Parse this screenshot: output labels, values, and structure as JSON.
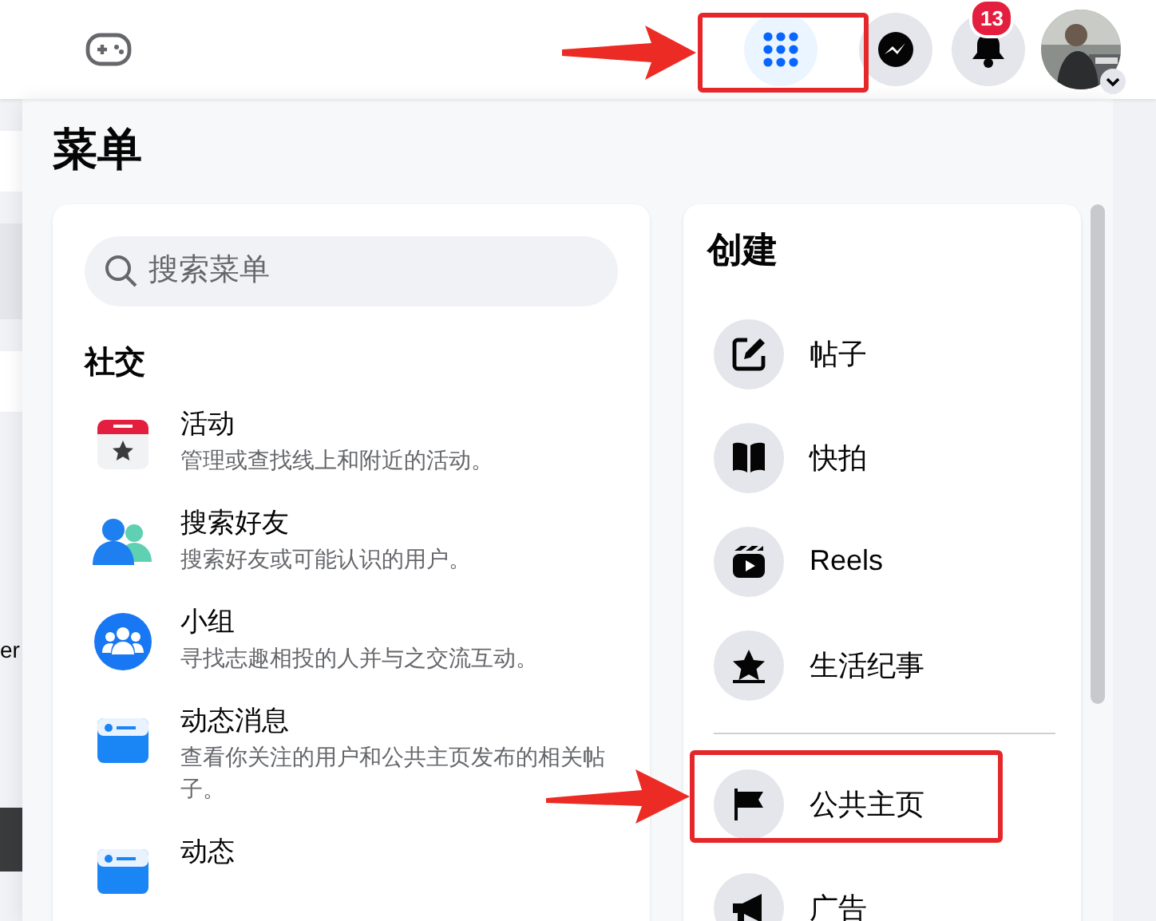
{
  "side_fragment": "er",
  "nav_buttons": [
    {
      "kind": "menu",
      "selected": true
    },
    {
      "kind": "messenger",
      "selected": false
    },
    {
      "kind": "notifications",
      "selected": false,
      "badge": "13"
    }
  ],
  "menu": {
    "title": "菜单",
    "search": {
      "placeholder": "搜索菜单"
    },
    "social": {
      "heading": "社交",
      "items": [
        {
          "kind": "events",
          "title": "活动",
          "description": "管理或查找线上和附近的活动。"
        },
        {
          "kind": "friends",
          "title": "搜索好友",
          "description": "搜索好友或可能认识的用户。"
        },
        {
          "kind": "groups",
          "title": "小组",
          "description": "寻找志趣相投的人并与之交流互动。"
        },
        {
          "kind": "feed",
          "title": "动态消息",
          "description": "查看你关注的用户和公共主页发布的相关帖子。"
        },
        {
          "kind": "feed",
          "title": "动态"
        }
      ]
    },
    "create": {
      "heading": "创建",
      "sections": [
        [
          {
            "kind": "post",
            "label": "帖子"
          },
          {
            "kind": "story",
            "label": "快拍"
          },
          {
            "kind": "reels",
            "label": "Reels"
          },
          {
            "kind": "life_event",
            "label": "生活纪事"
          }
        ],
        [
          {
            "kind": "page",
            "label": "公共主页"
          },
          {
            "kind": "ad",
            "label": "广告"
          }
        ]
      ]
    }
  }
}
